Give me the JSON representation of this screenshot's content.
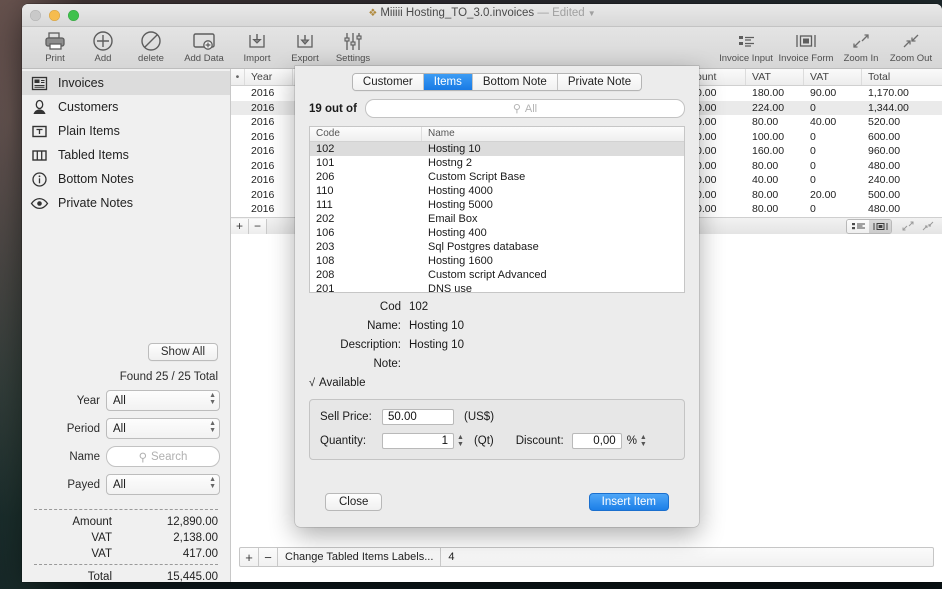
{
  "window": {
    "title": "Miiiii Hosting_TO_3.0.invoices",
    "title_suffix": "— Edited",
    "doc_icon": "document-icon"
  },
  "toolbar": {
    "left_items": [
      {
        "label": "Print",
        "icon": "printer-icon"
      },
      {
        "label": "Add",
        "icon": "plus-circle-icon"
      },
      {
        "label": "delete",
        "icon": "no-entry-icon"
      },
      {
        "label": "Add Data",
        "icon": "add-data-icon"
      },
      {
        "label": "Import",
        "icon": "import-icon"
      },
      {
        "label": "Export",
        "icon": "export-icon"
      },
      {
        "label": "Settings",
        "icon": "sliders-icon"
      }
    ],
    "right_items": [
      {
        "label": "Invoice Input",
        "icon": "list-icon"
      },
      {
        "label": "Invoice Form",
        "icon": "form-icon"
      },
      {
        "label": "Zoom In",
        "icon": "zoom-in-icon"
      },
      {
        "label": "Zoom Out",
        "icon": "zoom-out-icon"
      }
    ]
  },
  "sidebar": {
    "items": [
      {
        "label": "Invoices",
        "icon": "invoice-icon",
        "selected": true
      },
      {
        "label": "Customers",
        "icon": "person-icon",
        "selected": false
      },
      {
        "label": "Plain Items",
        "icon": "text-box-icon",
        "selected": false
      },
      {
        "label": "Tabled Items",
        "icon": "columns-icon",
        "selected": false
      },
      {
        "label": "Bottom Notes",
        "icon": "info-circle-icon",
        "selected": false
      },
      {
        "label": "Private Notes",
        "icon": "eye-icon",
        "selected": false
      }
    ],
    "show_all_label": "Show All",
    "found_text": "Found 25 / 25 Total",
    "filters": [
      {
        "label": "Year",
        "value": "All",
        "type": "select"
      },
      {
        "label": "Period",
        "value": "All",
        "type": "select"
      },
      {
        "label": "Name",
        "value": "Search",
        "type": "search"
      },
      {
        "label": "Payed",
        "value": "All",
        "type": "select"
      }
    ],
    "totals": [
      {
        "label": "Amount",
        "value": "12,890.00"
      },
      {
        "label": "VAT",
        "value": "2,138.00"
      },
      {
        "label": "VAT",
        "value": "417.00"
      }
    ],
    "grand_total": {
      "label": "Total",
      "value": "15,445.00"
    }
  },
  "main_table": {
    "columns": [
      "",
      "Year",
      "",
      "Amount",
      "VAT",
      "VAT",
      "Total"
    ],
    "col_year": "Year",
    "col_amount": "ount",
    "col_vat1": "VAT",
    "col_vat2": "VAT",
    "col_total": "Total",
    "rows": [
      {
        "year": "2016",
        "amount": "0.00",
        "vat1": "180.00",
        "vat2": "90.00",
        "total": "1,170.00",
        "selected": false
      },
      {
        "year": "2016",
        "amount": "0.00",
        "vat1": "224.00",
        "vat2": "0",
        "total": "1,344.00",
        "selected": true
      },
      {
        "year": "2016",
        "amount": "0.00",
        "vat1": "80.00",
        "vat2": "40.00",
        "total": "520.00",
        "selected": false
      },
      {
        "year": "2016",
        "amount": "0.00",
        "vat1": "100.00",
        "vat2": "0",
        "total": "600.00",
        "selected": false
      },
      {
        "year": "2016",
        "amount": "0.00",
        "vat1": "160.00",
        "vat2": "0",
        "total": "960.00",
        "selected": false
      },
      {
        "year": "2016",
        "amount": "0.00",
        "vat1": "80.00",
        "vat2": "0",
        "total": "480.00",
        "selected": false
      },
      {
        "year": "2016",
        "amount": "0.00",
        "vat1": "40.00",
        "vat2": "0",
        "total": "240.00",
        "selected": false
      },
      {
        "year": "2016",
        "amount": "0.00",
        "vat1": "80.00",
        "vat2": "20.00",
        "total": "500.00",
        "selected": false
      },
      {
        "year": "2016",
        "amount": "0.00",
        "vat1": "80.00",
        "vat2": "0",
        "total": "480.00",
        "selected": false
      }
    ]
  },
  "bottom_bar": {
    "add": "+",
    "remove": "−",
    "label": "Change Tabled Items Labels...",
    "value": "4"
  },
  "sheet": {
    "tabs": [
      {
        "label": "Customer",
        "active": false
      },
      {
        "label": "Items",
        "active": true
      },
      {
        "label": "Bottom Note",
        "active": false
      },
      {
        "label": "Private Note",
        "active": false
      }
    ],
    "search": {
      "count_label": "19 out of",
      "placeholder": "All",
      "icon": "search-icon"
    },
    "table": {
      "col_code": "Code",
      "col_name": "Name",
      "rows": [
        {
          "code": "102",
          "name": "Hosting 10",
          "selected": true
        },
        {
          "code": "101",
          "name": "Hostng 2",
          "selected": false
        },
        {
          "code": "206",
          "name": "Custom Script Base",
          "selected": false
        },
        {
          "code": "110",
          "name": "Hosting 4000",
          "selected": false
        },
        {
          "code": "111",
          "name": "Hosting 5000",
          "selected": false
        },
        {
          "code": "202",
          "name": "Email Box",
          "selected": false
        },
        {
          "code": "106",
          "name": "Hosting 400",
          "selected": false
        },
        {
          "code": "203",
          "name": "Sql Postgres database",
          "selected": false
        },
        {
          "code": "108",
          "name": "Hosting 1600",
          "selected": false
        },
        {
          "code": "208",
          "name": "Custom script Advanced",
          "selected": false
        },
        {
          "code": "201",
          "name": "DNS use",
          "selected": false
        }
      ]
    },
    "detail": {
      "code_label": "Cod",
      "code_value": "102",
      "name_label": "Name:",
      "name_value": "Hosting 10",
      "description_label": "Description:",
      "description_value": "Hosting 10",
      "note_label": "Note:",
      "note_value": "",
      "available_label": "Available",
      "available_check": "√"
    },
    "price": {
      "sell_price_label": "Sell Price:",
      "sell_price_value": "50.00",
      "currency": "(US$)",
      "quantity_label": "Quantity:",
      "quantity_value": "1",
      "quantity_unit": "(Qt)",
      "discount_label": "Discount:",
      "discount_value": "0,00",
      "percent": "%"
    },
    "close_label": "Close",
    "insert_label": "Insert Item"
  },
  "colors": {
    "accent_blue": "#1c7fe8",
    "selection_gray": "#dcdcdc",
    "window_bg": "#ececec"
  }
}
